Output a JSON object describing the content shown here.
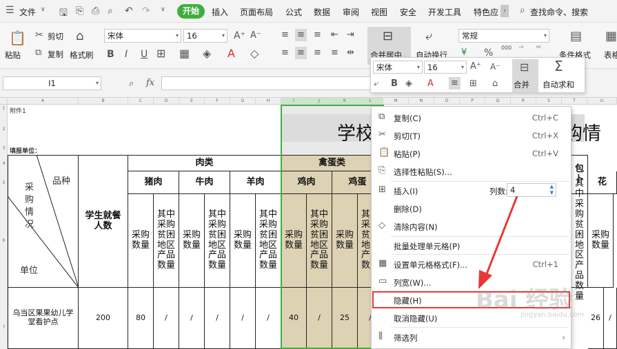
{
  "menu": {
    "file": "文件",
    "tabs": [
      "开始",
      "插入",
      "页面布局",
      "公式",
      "数据",
      "审阅",
      "视图",
      "安全",
      "开发工具",
      "特色应"
    ],
    "search": "查找命令、搜索"
  },
  "ribbon": {
    "paste": "粘贴",
    "cut": "剪切",
    "copy": "复制",
    "format_painter": "格式刷",
    "font": "宋体",
    "size": "16",
    "bold": "B",
    "italic": "I",
    "underline": "U",
    "merge": "合并居中",
    "wrap": "自动换行",
    "number_format": "常规",
    "cond_format": "条件格式",
    "table_style": "表格"
  },
  "formula_bar": {
    "cell_ref": "I1",
    "fx": "fx"
  },
  "mini_toolbar": {
    "font": "宋体",
    "size": "16",
    "bold": "B",
    "merge": "合并",
    "autosum": "自动求和"
  },
  "col_headers": [
    "A",
    "B",
    "C",
    "D",
    "E",
    "F",
    "G",
    "H",
    "I",
    "J",
    "K",
    "L",
    "M",
    "N",
    "O",
    "P",
    "Q",
    "R",
    "S",
    "T",
    "U"
  ],
  "row_headers": [
    "1",
    "2",
    "3",
    "4",
    "5",
    "6",
    "7"
  ],
  "sheet": {
    "attachment": "附件1",
    "title_left": "学校",
    "title_right": "购情",
    "unit_label": "填报单位：",
    "diag_pinzhong": "品种",
    "diag_caigou": "采购情况",
    "diag_danwei": "单位",
    "students": "学生就餐人数",
    "meat": "肉类",
    "poultry": "禽蛋类",
    "pork": "猪肉",
    "beef": "牛肉",
    "mutton": "羊肉",
    "chicken": "鸡肉",
    "egg": "鸡蛋",
    "bao": "包卜",
    "hua": "花",
    "qty": "采购数量",
    "poor_qty": "其中采购贫困地区产品数量",
    "row7": {
      "name": "乌当区果果幼儿学堂看护点",
      "students": "200",
      "pork": "80",
      "pork_poor": "/",
      "beef": "/",
      "beef_poor": "/",
      "mutton": "/",
      "mutton_poor": "/",
      "chicken": "40",
      "chicken_poor": "/",
      "egg": "25",
      "egg_poor": "/",
      "right_a": "26",
      "right_b": "/"
    }
  },
  "context_menu": {
    "items": [
      {
        "icon": "copy-icon",
        "label": "复制(C)",
        "shortcut": "Ctrl+C"
      },
      {
        "icon": "cut-icon",
        "label": "剪切(T)",
        "shortcut": "Ctrl+X"
      },
      {
        "icon": "paste-icon",
        "label": "粘贴(P)",
        "shortcut": "Ctrl+V"
      },
      {
        "icon": "paste-special-icon",
        "label": "选择性粘贴(S)...",
        "shortcut": ""
      },
      {
        "icon": "insert-icon",
        "label": "插入(I)",
        "shortcut": ""
      },
      {
        "icon": "",
        "label": "删除(D)",
        "shortcut": ""
      },
      {
        "icon": "eraser-icon",
        "label": "清除内容(N)",
        "shortcut": ""
      },
      {
        "icon": "",
        "label": "批量处理单元格(P)",
        "shortcut": ""
      },
      {
        "icon": "format-cells-icon",
        "label": "设置单元格格式(F)...",
        "shortcut": "Ctrl+1"
      },
      {
        "icon": "column-width-icon",
        "label": "列宽(W)...",
        "shortcut": ""
      },
      {
        "icon": "",
        "label": "隐藏(H)",
        "shortcut": ""
      },
      {
        "icon": "",
        "label": "取消隐藏(U)",
        "shortcut": ""
      },
      {
        "icon": "filter-column-icon",
        "label": "筛选列",
        "shortcut": ""
      }
    ],
    "col_count_label": "列数:",
    "col_count_value": "4"
  },
  "watermark": "Bai 经验",
  "watermark_url": "jingyan.baidu.com",
  "accent": "#3fae3f",
  "highlight": "#e53935",
  "tan": "#ddd2b4"
}
